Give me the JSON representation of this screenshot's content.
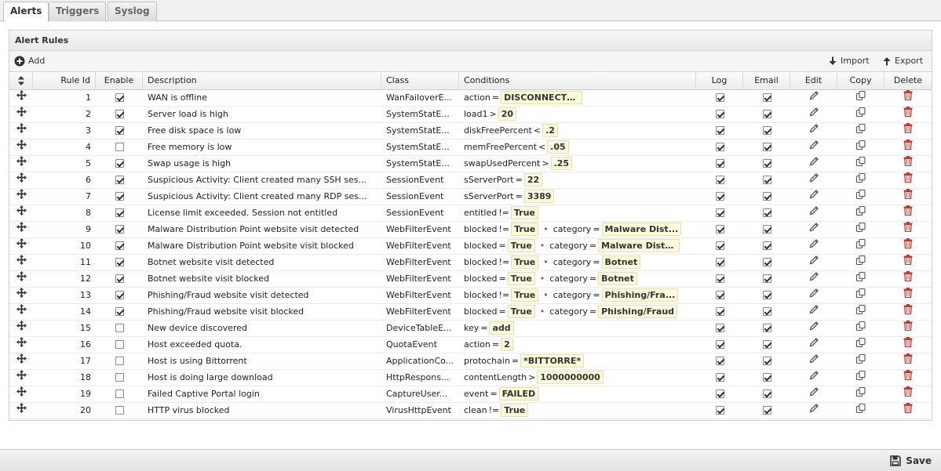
{
  "tabs": [
    {
      "label": "Alerts",
      "active": true
    },
    {
      "label": "Triggers",
      "active": false
    },
    {
      "label": "Syslog",
      "active": false
    }
  ],
  "panel": {
    "title": "Alert Rules"
  },
  "toolbar": {
    "add_label": "Add",
    "import_label": "Import",
    "export_label": "Export"
  },
  "columns": [
    "Rule Id",
    "Enable",
    "Description",
    "Class",
    "Conditions",
    "Log",
    "Email",
    "Edit",
    "Copy",
    "Delete"
  ],
  "icons": {
    "drag": "move-arrows-icon",
    "edit": "pencil-icon",
    "copy": "copy-icon",
    "delete": "trash-icon",
    "add": "plus-circle-icon",
    "import": "arrow-down-icon",
    "export": "arrow-up-icon",
    "save": "floppy-disk-icon"
  },
  "colors": {
    "delete_icon": "#c0392b",
    "value_bg": "#fcf9dc"
  },
  "rows": [
    {
      "id": "1",
      "enabled": true,
      "description": "WAN is offline",
      "class": "WanFailoverE...",
      "log": true,
      "email": true,
      "conditions": [
        {
          "field": "action",
          "op": "=",
          "value": "DISCONNECTED"
        }
      ]
    },
    {
      "id": "2",
      "enabled": true,
      "description": "Server load is high",
      "class": "SystemStatE...",
      "log": true,
      "email": true,
      "conditions": [
        {
          "field": "load1",
          "op": ">",
          "value": "20"
        }
      ]
    },
    {
      "id": "3",
      "enabled": true,
      "description": "Free disk space is low",
      "class": "SystemStatE...",
      "log": true,
      "email": true,
      "conditions": [
        {
          "field": "diskFreePercent",
          "op": "<",
          "value": ".2"
        }
      ]
    },
    {
      "id": "4",
      "enabled": false,
      "description": "Free memory is low",
      "class": "SystemStatE...",
      "log": true,
      "email": true,
      "conditions": [
        {
          "field": "memFreePercent",
          "op": "<",
          "value": ".05"
        }
      ]
    },
    {
      "id": "5",
      "enabled": true,
      "description": "Swap usage is high",
      "class": "SystemStatE...",
      "log": true,
      "email": true,
      "conditions": [
        {
          "field": "swapUsedPercent",
          "op": ">",
          "value": ".25"
        }
      ]
    },
    {
      "id": "6",
      "enabled": true,
      "description": "Suspicious Activity: Client created many SSH ses...",
      "class": "SessionEvent",
      "log": true,
      "email": true,
      "conditions": [
        {
          "field": "sServerPort",
          "op": "=",
          "value": "22"
        }
      ]
    },
    {
      "id": "7",
      "enabled": true,
      "description": "Suspicious Activity: Client created many RDP ses...",
      "class": "SessionEvent",
      "log": true,
      "email": true,
      "conditions": [
        {
          "field": "sServerPort",
          "op": "=",
          "value": "3389"
        }
      ]
    },
    {
      "id": "8",
      "enabled": true,
      "description": "License limit exceeded. Session not entitled",
      "class": "SessionEvent",
      "log": true,
      "email": true,
      "conditions": [
        {
          "field": "entitled",
          "op": "!=",
          "value": "True"
        }
      ]
    },
    {
      "id": "9",
      "enabled": true,
      "description": "Malware Distribution Point website visit detected",
      "class": "WebFilterEvent",
      "log": true,
      "email": true,
      "conditions": [
        {
          "field": "blocked",
          "op": "!=",
          "value": "True"
        },
        {
          "field": "category",
          "op": "=",
          "value": "Malware Dist..."
        }
      ]
    },
    {
      "id": "10",
      "enabled": true,
      "description": "Malware Distribution Point website visit blocked",
      "class": "WebFilterEvent",
      "log": true,
      "email": true,
      "conditions": [
        {
          "field": "blocked",
          "op": "=",
          "value": "True"
        },
        {
          "field": "category",
          "op": "=",
          "value": "Malware Distr..."
        }
      ]
    },
    {
      "id": "11",
      "enabled": true,
      "description": "Botnet website visit detected",
      "class": "WebFilterEvent",
      "log": true,
      "email": true,
      "conditions": [
        {
          "field": "blocked",
          "op": "!=",
          "value": "True"
        },
        {
          "field": "category",
          "op": "=",
          "value": "Botnet"
        }
      ]
    },
    {
      "id": "12",
      "enabled": true,
      "description": "Botnet website visit blocked",
      "class": "WebFilterEvent",
      "log": true,
      "email": true,
      "conditions": [
        {
          "field": "blocked",
          "op": "=",
          "value": "True"
        },
        {
          "field": "category",
          "op": "=",
          "value": "Botnet"
        }
      ]
    },
    {
      "id": "13",
      "enabled": true,
      "description": "Phishing/Fraud website visit detected",
      "class": "WebFilterEvent",
      "log": true,
      "email": true,
      "conditions": [
        {
          "field": "blocked",
          "op": "!=",
          "value": "True"
        },
        {
          "field": "category",
          "op": "=",
          "value": "Phishing/Fra..."
        }
      ]
    },
    {
      "id": "14",
      "enabled": true,
      "description": "Phishing/Fraud website visit blocked",
      "class": "WebFilterEvent",
      "log": true,
      "email": true,
      "conditions": [
        {
          "field": "blocked",
          "op": "=",
          "value": "True"
        },
        {
          "field": "category",
          "op": "=",
          "value": "Phishing/Fraud"
        }
      ]
    },
    {
      "id": "15",
      "enabled": false,
      "description": "New device discovered",
      "class": "DeviceTableE...",
      "log": true,
      "email": true,
      "conditions": [
        {
          "field": "key",
          "op": "=",
          "value": "add"
        }
      ]
    },
    {
      "id": "16",
      "enabled": false,
      "description": "Host exceeded quota.",
      "class": "QuotaEvent",
      "log": true,
      "email": true,
      "conditions": [
        {
          "field": "action",
          "op": "=",
          "value": "2"
        }
      ]
    },
    {
      "id": "17",
      "enabled": false,
      "description": "Host is using Bittorrent",
      "class": "ApplicationCo...",
      "log": true,
      "email": true,
      "conditions": [
        {
          "field": "protochain",
          "op": "=",
          "value": "*BITTORRE*"
        }
      ]
    },
    {
      "id": "18",
      "enabled": false,
      "description": "Host is doing large download",
      "class": "HttpRespons...",
      "log": true,
      "email": true,
      "conditions": [
        {
          "field": "contentLength",
          "op": ">",
          "value": "1000000000"
        }
      ]
    },
    {
      "id": "19",
      "enabled": false,
      "description": "Failed Captive Portal login",
      "class": "CaptureUser...",
      "log": true,
      "email": true,
      "conditions": [
        {
          "field": "event",
          "op": "=",
          "value": "FAILED"
        }
      ]
    },
    {
      "id": "20",
      "enabled": false,
      "description": "HTTP virus blocked",
      "class": "VirusHttpEvent",
      "log": true,
      "email": true,
      "conditions": [
        {
          "field": "clean",
          "op": "!=",
          "value": "True"
        }
      ]
    }
  ],
  "footer": {
    "save_label": "Save"
  }
}
